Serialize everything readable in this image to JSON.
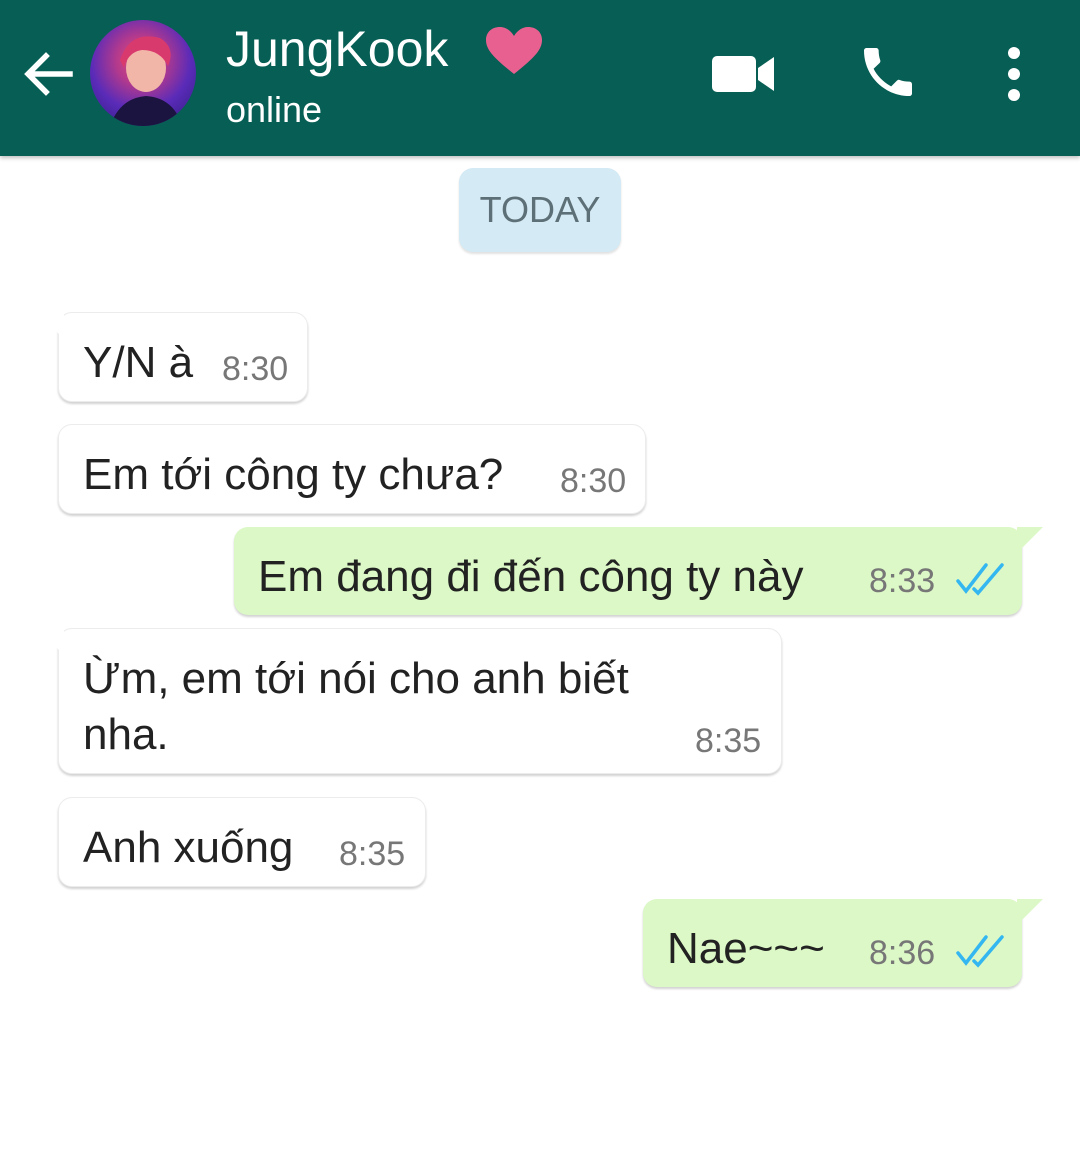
{
  "header": {
    "contact_name": "JungKook",
    "status": "online",
    "background_color": "#075e54",
    "heart_color": "#e8608f"
  },
  "date_chip": "TODAY",
  "messages": [
    {
      "direction": "in",
      "text": "Y/N à",
      "time": "8:30"
    },
    {
      "direction": "in",
      "text": "Em tới công ty chưa?",
      "time": "8:30"
    },
    {
      "direction": "out",
      "text": "Em đang đi đến công ty này",
      "time": "8:33",
      "read": true
    },
    {
      "direction": "in",
      "text": "Ừm,  em tới nói cho anh biết nha.",
      "time": "8:35"
    },
    {
      "direction": "in",
      "text": "Anh xuống",
      "time": "8:35"
    },
    {
      "direction": "out",
      "text": "Nae~~~",
      "time": "8:36",
      "read": true
    }
  ],
  "icons": {
    "back": "arrow-left-icon",
    "video": "video-camera-icon",
    "call": "phone-icon",
    "more": "more-vertical-icon",
    "read_receipt": "double-check-icon"
  },
  "colors": {
    "incoming_bubble": "#ffffff",
    "outgoing_bubble": "#dcf8c6",
    "date_chip": "#d4eaf4",
    "read_tick": "#34b7f1"
  }
}
